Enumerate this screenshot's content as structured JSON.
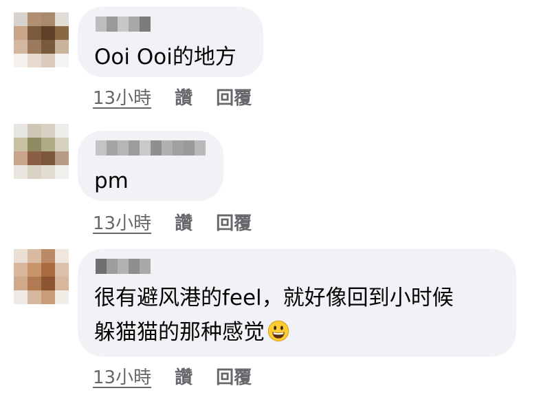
{
  "comments": [
    {
      "text_lines": [
        "Ooi Ooi的地方"
      ],
      "timestamp": "13小時",
      "like_label": "讚",
      "reply_label": "回覆",
      "has_emoji": false
    },
    {
      "text_lines": [
        "pm"
      ],
      "timestamp": "13小時",
      "like_label": "讚",
      "reply_label": "回覆",
      "has_emoji": false
    },
    {
      "text_lines": [
        "很有避风港的feel，就好像回到小时候",
        "躲猫猫的那种感觉"
      ],
      "timestamp": "13小時",
      "like_label": "讚",
      "reply_label": "回覆",
      "has_emoji": true,
      "emoji_icon": "grinning-face-emoji"
    }
  ],
  "colors": {
    "bubble_bg": "#f0f2f5",
    "text": "#050505",
    "secondary_text": "#65676b"
  }
}
